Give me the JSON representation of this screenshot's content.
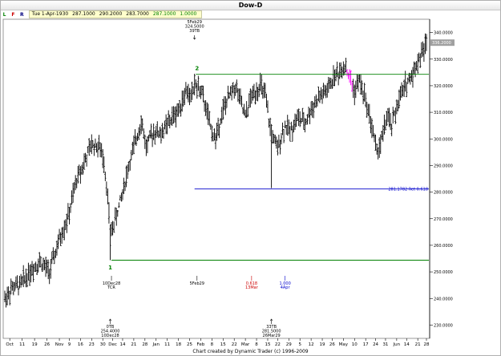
{
  "window": {
    "title": "Dow-D"
  },
  "toolbar": {
    "buttons": [
      {
        "label": "L",
        "color": "#008000"
      },
      {
        "label": "F",
        "color": "#cc0000"
      },
      {
        "label": "R",
        "color": "#000080"
      }
    ],
    "date": "Tue 1-Apr-1930",
    "open": "287.1000",
    "high": "290.2000",
    "low": "283.7000",
    "close": "287.1000",
    "volume": "1.0000"
  },
  "footer": {
    "credit": "Chart created by Dynamic Trader  (c) 1996-2009"
  },
  "chart_data": {
    "type": "ohlc",
    "title": "Dow-D",
    "ylim": [
      225,
      345
    ],
    "y_ticks": [
      230,
      240,
      250,
      260,
      270,
      280,
      290,
      300,
      310,
      320,
      330,
      340
    ],
    "y_tick_labels": [
      "230.0000",
      "240.0000",
      "250.0000",
      "260.0000",
      "270.0000",
      "280.0000",
      "290.0000",
      "300.0000",
      "310.0000",
      "320.0000",
      "330.0000",
      "340.0000"
    ],
    "last_price_label": "336.2000",
    "last_price": 336.2,
    "x_ticks": [
      {
        "i": 4,
        "label": "Oct"
      },
      {
        "i": 14,
        "label": "11"
      },
      {
        "i": 24,
        "label": "19"
      },
      {
        "i": 34,
        "label": "26"
      },
      {
        "i": 44,
        "label": "Nov"
      },
      {
        "i": 52,
        "label": "9"
      },
      {
        "i": 61,
        "label": "16"
      },
      {
        "i": 70,
        "label": "23"
      },
      {
        "i": 79,
        "label": "30"
      },
      {
        "i": 87,
        "label": "Dec"
      },
      {
        "i": 95,
        "label": "14"
      },
      {
        "i": 104,
        "label": "21"
      },
      {
        "i": 113,
        "label": "28"
      },
      {
        "i": 122,
        "label": "Jan"
      },
      {
        "i": 131,
        "label": "11"
      },
      {
        "i": 140,
        "label": "18"
      },
      {
        "i": 149,
        "label": "25"
      },
      {
        "i": 158,
        "label": "Feb"
      },
      {
        "i": 167,
        "label": "8"
      },
      {
        "i": 176,
        "label": "15"
      },
      {
        "i": 185,
        "label": "22"
      },
      {
        "i": 194,
        "label": "Mar"
      },
      {
        "i": 203,
        "label": "8"
      },
      {
        "i": 212,
        "label": "15"
      },
      {
        "i": 220,
        "label": "22"
      },
      {
        "i": 229,
        "label": "29"
      },
      {
        "i": 238,
        "label": "5"
      },
      {
        "i": 247,
        "label": "12"
      },
      {
        "i": 256,
        "label": "19"
      },
      {
        "i": 264,
        "label": "26"
      },
      {
        "i": 273,
        "label": "May"
      },
      {
        "i": 282,
        "label": "10"
      },
      {
        "i": 291,
        "label": "17"
      },
      {
        "i": 299,
        "label": "24"
      },
      {
        "i": 307,
        "label": "31"
      },
      {
        "i": 316,
        "label": "Jun"
      },
      {
        "i": 324,
        "label": "14"
      },
      {
        "i": 333,
        "label": "21"
      },
      {
        "i": 340,
        "label": "28"
      }
    ],
    "anchors": [
      [
        0,
        240
      ],
      [
        6,
        244
      ],
      [
        12,
        245
      ],
      [
        20,
        250
      ],
      [
        28,
        254
      ],
      [
        36,
        250
      ],
      [
        44,
        262
      ],
      [
        52,
        272
      ],
      [
        58,
        285
      ],
      [
        64,
        291
      ],
      [
        70,
        298
      ],
      [
        76,
        297
      ],
      [
        80,
        292
      ],
      [
        83,
        278
      ],
      [
        85,
        264
      ],
      [
        88,
        268
      ],
      [
        94,
        278
      ],
      [
        100,
        290
      ],
      [
        106,
        300
      ],
      [
        110,
        307
      ],
      [
        114,
        297
      ],
      [
        120,
        303
      ],
      [
        126,
        302
      ],
      [
        132,
        306
      ],
      [
        140,
        311
      ],
      [
        146,
        318
      ],
      [
        150,
        316
      ],
      [
        154,
        320
      ],
      [
        158,
        318
      ],
      [
        162,
        312
      ],
      [
        166,
        304
      ],
      [
        170,
        300
      ],
      [
        174,
        308
      ],
      [
        178,
        313
      ],
      [
        182,
        317
      ],
      [
        186,
        320
      ],
      [
        190,
        314
      ],
      [
        194,
        308
      ],
      [
        198,
        315
      ],
      [
        202,
        318
      ],
      [
        206,
        320
      ],
      [
        210,
        316
      ],
      [
        214,
        304
      ],
      [
        218,
        298
      ],
      [
        220,
        296
      ],
      [
        222,
        300
      ],
      [
        226,
        305
      ],
      [
        230,
        303
      ],
      [
        236,
        308
      ],
      [
        242,
        306
      ],
      [
        248,
        312
      ],
      [
        254,
        316
      ],
      [
        260,
        318
      ],
      [
        266,
        324
      ],
      [
        270,
        325
      ],
      [
        274,
        328
      ],
      [
        278,
        323
      ],
      [
        282,
        318
      ],
      [
        286,
        322
      ],
      [
        290,
        316
      ],
      [
        294,
        309
      ],
      [
        298,
        300
      ],
      [
        300,
        295
      ],
      [
        304,
        300
      ],
      [
        308,
        308
      ],
      [
        312,
        305
      ],
      [
        316,
        312
      ],
      [
        320,
        317
      ],
      [
        324,
        321
      ],
      [
        328,
        324
      ],
      [
        332,
        328
      ],
      [
        336,
        332
      ],
      [
        340,
        336
      ]
    ],
    "bars_count": 341,
    "lines": [
      {
        "name": "upper-horizontal",
        "from_i": 154,
        "to_i": 341,
        "y": 324.3,
        "color": "#008000"
      },
      {
        "name": "lower-horizontal",
        "from_i": 86,
        "to_i": 341,
        "y": 254.4,
        "color": "#008000"
      },
      {
        "name": "retracement",
        "from_i": 153,
        "to_i": 341,
        "y": 281.1782,
        "color": "#0000cc"
      }
    ],
    "retracement_label": "281.1782 Ret 0.618",
    "pivot_labels": [
      {
        "text": "2",
        "i": 155,
        "y": 325.2,
        "color": "#008000"
      },
      {
        "text": "1",
        "i": 85,
        "y": 254.0,
        "color": "#008000"
      }
    ],
    "annotations": [
      {
        "i": 153,
        "lines": [
          "5Feb29",
          "324.5000",
          "39TB"
        ],
        "pos": "top",
        "color": "#000000"
      },
      {
        "i": 85,
        "lines": [
          "0TB",
          "254.4000",
          "10Dec28"
        ],
        "pos": "bottom",
        "color": "#000000"
      },
      {
        "i": 215,
        "lines": [
          "33TB",
          "281.5000",
          "26Mar29"
        ],
        "pos": "bottom",
        "color": "#000000"
      }
    ],
    "time_marks": [
      {
        "i": 86,
        "lines": [
          "10Dec28",
          "TCR"
        ],
        "color": "#000000"
      },
      {
        "i": 155,
        "lines": [
          "5Feb29"
        ],
        "color": "#000000"
      },
      {
        "i": 199,
        "lines": [
          "0.618",
          "13Mar"
        ],
        "color": "#cc0000"
      },
      {
        "i": 226,
        "lines": [
          "1.000",
          "4Apr"
        ],
        "color": "#0000cc"
      }
    ],
    "highlight_bars": {
      "from_i": 276,
      "to_i": 280,
      "color": "#ff00ff"
    }
  }
}
